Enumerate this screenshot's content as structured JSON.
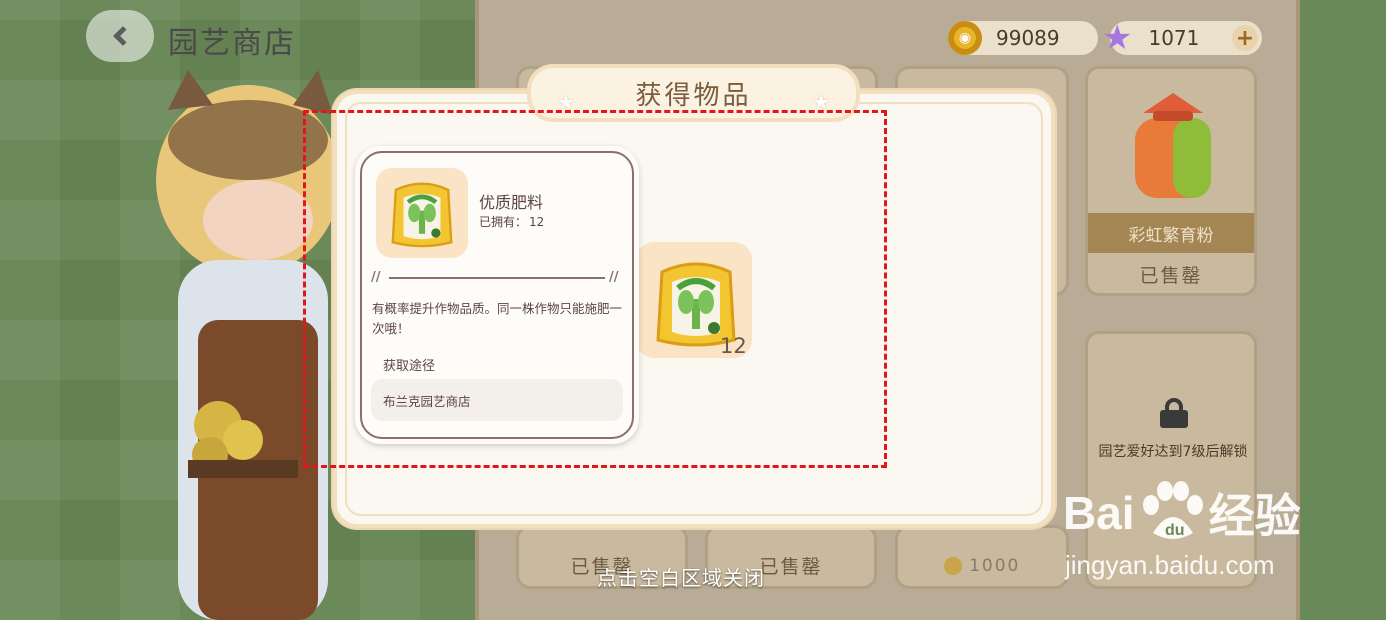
{
  "header": {
    "title": "园艺商店"
  },
  "currency": {
    "coins": "99089",
    "stars": "1071",
    "add_label": "+"
  },
  "shop": {
    "cards": [
      {
        "label": "彩虹繁育粉",
        "status": "已售罄"
      },
      {
        "lock_text": "园艺爱好达到7级后解锁"
      },
      {
        "status": "已售罄"
      },
      {
        "status": "已售罄"
      },
      {
        "price": "1000"
      }
    ]
  },
  "dialog": {
    "title": "获得物品"
  },
  "item": {
    "name": "优质肥料",
    "owned_label": "已拥有：",
    "owned_value": "12",
    "description": "有概率提升作物品质。同一株作物只能施肥一次哦！",
    "source_title": "获取途径",
    "source": "布兰克园艺商店",
    "count": "12",
    "icon": "fertilizer-bag-icon"
  },
  "close_hint": "点击空白区域关闭",
  "watermark": {
    "logo_left": "Bai",
    "logo_right": "经验",
    "url": "jingyan.baidu.com"
  },
  "colors": {
    "annotation_box": "#e0161a",
    "dialog_bg": "#fbf7f1",
    "card_label": "#a48654"
  }
}
